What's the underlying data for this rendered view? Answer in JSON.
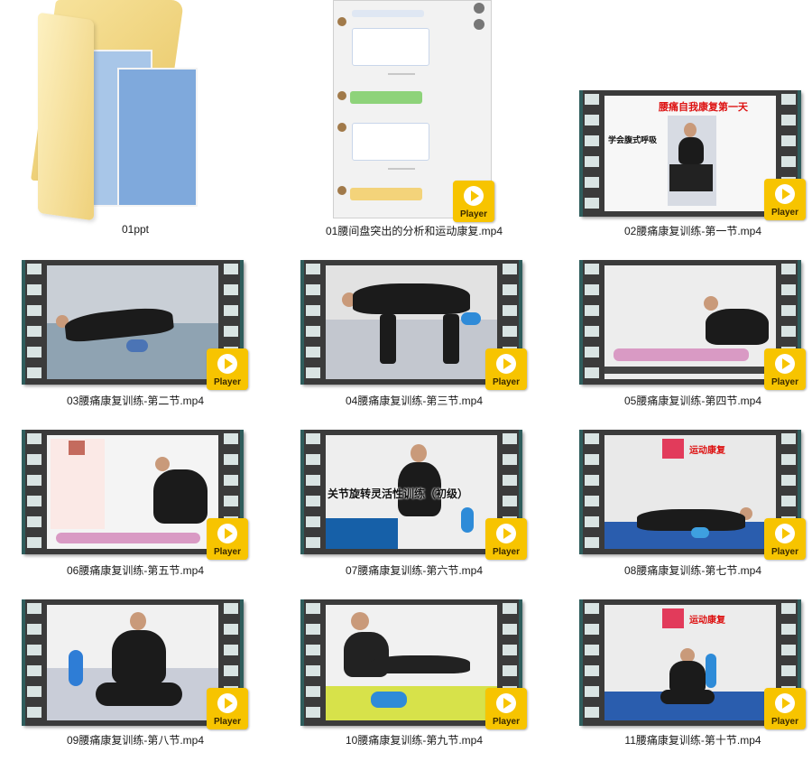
{
  "items": [
    {
      "label": "01ppt"
    },
    {
      "label": "01腰间盘突出的分析和运动康复.mp4"
    },
    {
      "label": "02腰痛康复训练-第一节.mp4"
    },
    {
      "label": "03腰痛康复训练-第二节.mp4"
    },
    {
      "label": "04腰痛康复训练-第三节.mp4"
    },
    {
      "label": "05腰痛康复训练-第四节.mp4"
    },
    {
      "label": "06腰痛康复训练-第五节.mp4"
    },
    {
      "label": "07腰痛康复训练-第六节.mp4"
    },
    {
      "label": "08腰痛康复训练-第七节.mp4"
    },
    {
      "label": "09腰痛康复训练-第八节.mp4"
    },
    {
      "label": "10腰痛康复训练-第九节.mp4"
    },
    {
      "label": "11腰痛康复训练-第十节.mp4"
    }
  ],
  "player_label": "Player",
  "thumb_text": {
    "video02_title": "腰痛自我康复第一天",
    "video02_sub": "学会腹式呼吸",
    "video07_title": "关节旋转灵活性训练（初级）",
    "video08_brand": "运动康复",
    "video11_brand": "运动康复"
  },
  "colors": {
    "player_badge": "#f7c400",
    "film_frame": "#3b3b3b",
    "film_teal": "#2f5d5c"
  }
}
